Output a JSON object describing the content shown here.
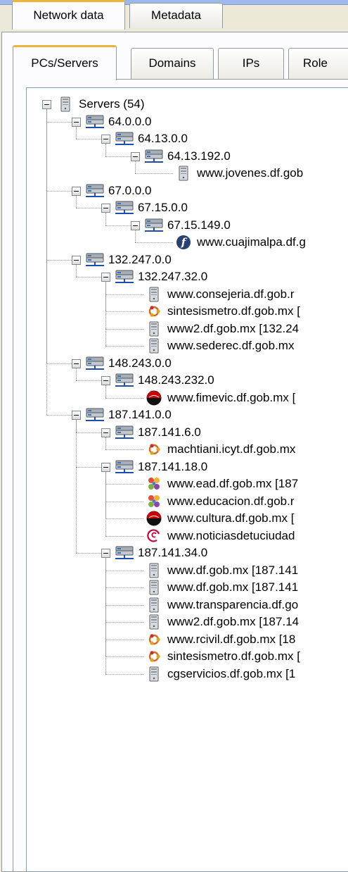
{
  "tabs": {
    "network_data": "Network data",
    "metadata": "Metadata"
  },
  "subtabs": {
    "pcs_servers": "PCs/Servers",
    "domains": "Domains",
    "ips": "IPs",
    "roles": "Role"
  },
  "tree": [
    {
      "label": "Servers (54)",
      "icon": "server-tower-icon",
      "level": 0,
      "expanded": true
    },
    {
      "label": "64.0.0.0",
      "icon": "network-icon",
      "level": 1,
      "expanded": true
    },
    {
      "label": "64.13.0.0",
      "icon": "network-icon",
      "level": 2,
      "expanded": true
    },
    {
      "label": "64.13.192.0",
      "icon": "network-icon",
      "level": 3,
      "expanded": true
    },
    {
      "label": "www.jovenes.df.gob",
      "icon": "server-tower-icon",
      "level": 4,
      "expanded": null
    },
    {
      "label": "67.0.0.0",
      "icon": "network-icon",
      "level": 1,
      "expanded": true
    },
    {
      "label": "67.15.0.0",
      "icon": "network-icon",
      "level": 2,
      "expanded": true
    },
    {
      "label": "67.15.149.0",
      "icon": "network-icon",
      "level": 3,
      "expanded": true
    },
    {
      "label": "www.cuajimalpa.df.g",
      "icon": "fedora-icon",
      "level": 4,
      "expanded": null
    },
    {
      "label": "132.247.0.0",
      "icon": "network-icon",
      "level": 1,
      "expanded": true
    },
    {
      "label": "132.247.32.0",
      "icon": "network-icon",
      "level": 2,
      "expanded": true
    },
    {
      "label": "www.consejeria.df.gob.r",
      "icon": "server-tower-icon",
      "level": 3,
      "expanded": null
    },
    {
      "label": "sintesismetro.df.gob.mx [",
      "icon": "ubuntu-icon",
      "level": 3,
      "expanded": null
    },
    {
      "label": "www2.df.gob.mx [132.24",
      "icon": "server-tower-icon",
      "level": 3,
      "expanded": null
    },
    {
      "label": "www.sederec.df.gob.mx",
      "icon": "server-tower-icon",
      "level": 3,
      "expanded": null
    },
    {
      "label": "148.243.0.0",
      "icon": "network-icon",
      "level": 1,
      "expanded": true
    },
    {
      "label": "148.243.232.0",
      "icon": "network-icon",
      "level": 2,
      "expanded": true
    },
    {
      "label": "www.fimevic.df.gob.mx [",
      "icon": "redhat-icon",
      "level": 3,
      "expanded": null
    },
    {
      "label": "187.141.0.0",
      "icon": "network-icon",
      "level": 1,
      "expanded": true
    },
    {
      "label": "187.141.6.0",
      "icon": "network-icon",
      "level": 2,
      "expanded": true
    },
    {
      "label": "machtiani.icyt.df.gob.mx",
      "icon": "ubuntu-icon",
      "level": 3,
      "expanded": null
    },
    {
      "label": "187.141.18.0",
      "icon": "network-icon",
      "level": 2,
      "expanded": true
    },
    {
      "label": "www.ead.df.gob.mx [187",
      "icon": "suse-icon",
      "level": 3,
      "expanded": null
    },
    {
      "label": "www.educacion.df.gob.r",
      "icon": "suse-icon",
      "level": 3,
      "expanded": null
    },
    {
      "label": "www.cultura.df.gob.mx [",
      "icon": "redhat-icon",
      "level": 3,
      "expanded": null
    },
    {
      "label": "www.noticiasdetuciudad",
      "icon": "debian-icon",
      "level": 3,
      "expanded": null
    },
    {
      "label": "187.141.34.0",
      "icon": "network-icon",
      "level": 2,
      "expanded": true
    },
    {
      "label": "www.df.gob.mx [187.141",
      "icon": "server-tower-icon",
      "level": 3,
      "expanded": null
    },
    {
      "label": "www.df.gob.mx [187.141",
      "icon": "server-tower-icon",
      "level": 3,
      "expanded": null
    },
    {
      "label": "www.transparencia.df.go",
      "icon": "server-tower-icon",
      "level": 3,
      "expanded": null
    },
    {
      "label": "www2.df.gob.mx [187.14",
      "icon": "server-tower-icon",
      "level": 3,
      "expanded": null
    },
    {
      "label": "www.rcivil.df.gob.mx [18",
      "icon": "ubuntu-icon",
      "level": 3,
      "expanded": null
    },
    {
      "label": "sintesismetro.df.gob.mx [",
      "icon": "ubuntu-icon",
      "level": 3,
      "expanded": null
    },
    {
      "label": "cgservicios.df.gob.mx [1",
      "icon": "server-tower-icon",
      "level": 3,
      "expanded": null
    }
  ]
}
